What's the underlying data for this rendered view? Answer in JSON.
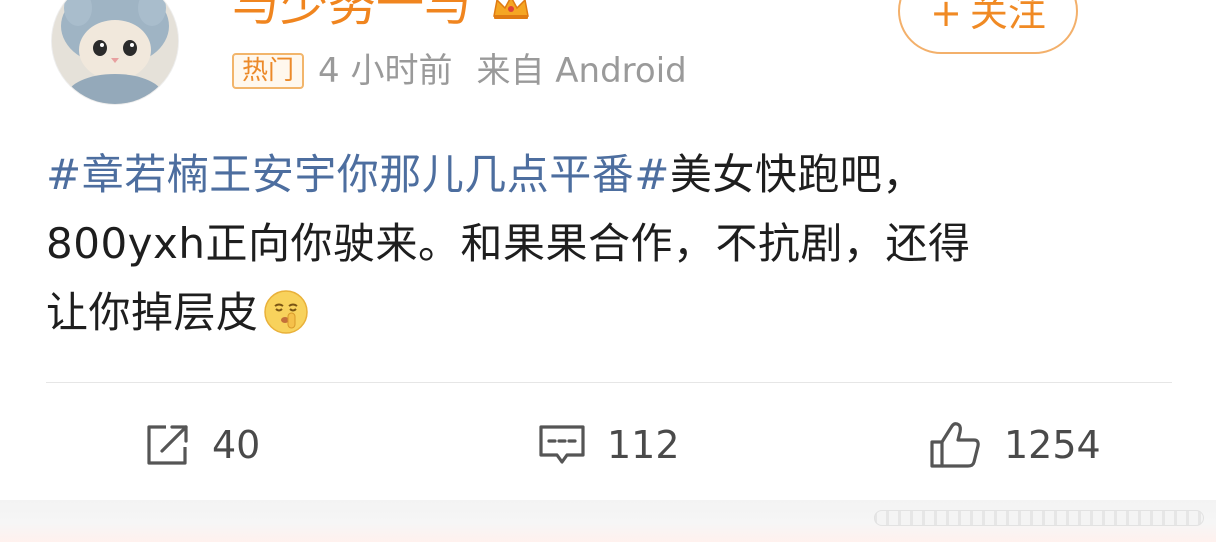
{
  "post": {
    "username": "与少努一与",
    "follow_label": "关注",
    "hot_badge": "热门",
    "time_ago": "4 小时前",
    "source": "来自 Android",
    "content": {
      "topic": "#章若楠王安宇你那儿几点平番#",
      "line1_rest": "美女快跑吧，",
      "line2": "800yxh正向你驶来。和果果合作，不抗剧，还得",
      "line3": "让你掉层皮"
    },
    "actions": {
      "repost_count": "40",
      "comment_count": "112",
      "like_count": "1254"
    }
  },
  "icons": {
    "avatar": "kitten-in-blue-hat-avatar",
    "crown": "crown-icon",
    "emoji": "shushing-face-emoji",
    "repost": "share-icon",
    "comment": "comment-icon",
    "like": "thumbs-up-icon"
  },
  "colors": {
    "accent_orange": "#f08a24",
    "topic_blue": "#4d6e9f",
    "meta_gray": "#9a9a9a",
    "text_dark": "#1e1e1e"
  }
}
